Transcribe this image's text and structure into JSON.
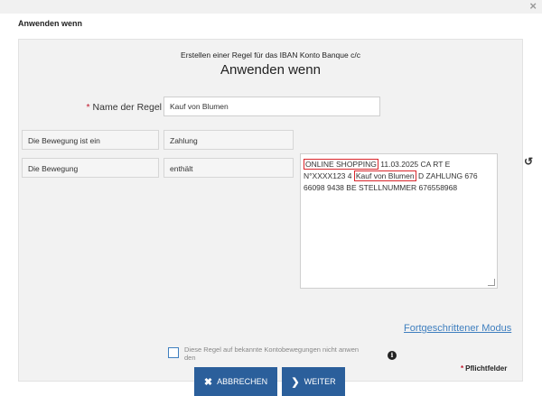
{
  "window": {
    "close_icon": "×"
  },
  "dialog": {
    "title": "Anwenden wenn",
    "subtitle": "Erstellen einer Regel für das IBAN Konto Banque c/c",
    "heading": "Anwenden wenn"
  },
  "form": {
    "name_label": "Name der Regel",
    "required_star": "*",
    "name_value": "Kauf von Blumen",
    "movement_type_label": "Die Bewegung ist ein",
    "movement_type_value": "Zahlung",
    "movement_label": "Die Bewegung",
    "operator_value": "enthält",
    "text_part1": "ONLINE SHOPPING",
    "text_part2": " 11.03.2025 CA RT E N°XXXX123 4 ",
    "text_part3": "Kauf von Blumen",
    "text_part4": " D ZAHLUNG 676 66098 9438 BE STELLNUMMER 676558968",
    "reset_icon": "↺",
    "advanced_mode_link": "Fortgeschrittener Modus",
    "apply_known_label": "Diese Regel auf bekannte Kontobewegungen nicht anwen den",
    "info_icon": "i",
    "required_note": "Pflichtfelder"
  },
  "buttons": {
    "cancel_label": "ABBRECHEN",
    "cancel_icon": "✖",
    "next_label": "WEITER",
    "next_icon": "❯"
  },
  "colors": {
    "primary_button": "#2b5f9b",
    "link": "#3f7fbf",
    "required": "#c0162b",
    "highlight": "#d9262b"
  }
}
